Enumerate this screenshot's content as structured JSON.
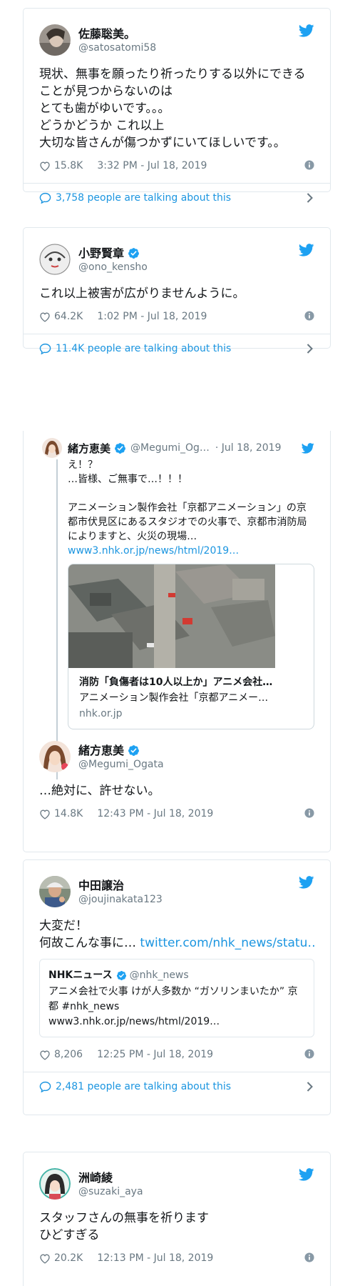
{
  "tweet1": {
    "name": "佐藤聡美。",
    "handle": "@satosatomi58",
    "text": "現状、無事を願ったり祈ったりする以外にできることが見つからないのは\nとても歯がゆいです。。。\nどうかどうか これ以上\n大切な皆さんが傷つかずにいてほしいです。。",
    "likes": "15.8K",
    "time": "3:32 PM - Jul 18, 2019",
    "talking": "3,758 people are talking about this"
  },
  "tweet2": {
    "name": "小野賢章",
    "handle": "@ono_kensho",
    "text": "これ以上被害が広がりませんように。",
    "likes": "64.2K",
    "time": "1:02 PM - Jul 18, 2019",
    "talking": "11.4K people are talking about this"
  },
  "tweet3": {
    "parent": {
      "name": "緒方恵美",
      "handle": "@Megumi_Og…",
      "date": "· Jul 18, 2019",
      "text": "え！？\n…皆様、ご無事で…！！！\n\nアニメーション製作会社「京都アニメーション」の京都市伏見区にあるスタジオでの火事で、京都市消防局によりますと、火災の現場…",
      "link": "www3.nhk.or.jp/news/html/2019…",
      "card_title": "消防「負傷者は10人以上か」アニメ会社…",
      "card_desc": "アニメーション製作会社「京都アニメー…",
      "card_domain": "nhk.or.jp"
    },
    "name": "緒方恵美",
    "handle": "@Megumi_Ogata",
    "text": "…絶対に、許せない。",
    "likes": "14.8K",
    "time": "12:43 PM - Jul 18, 2019"
  },
  "tweet4": {
    "name": "中田譲治",
    "handle": "@joujinakata123",
    "text_line1": "大変だ！",
    "text_line2_prefix": "何故こんな事に… ",
    "text_link": "twitter.com/nhk_news/statu…",
    "quote_name": "NHKニュース",
    "quote_handle": "@nhk_news",
    "quote_text": "アニメ会社で火事 けが人多数か “ガソリンまいたか” 京都 #nhk_news",
    "quote_link": "www3.nhk.or.jp/news/html/2019…",
    "likes": "8,206",
    "time": "12:25 PM - Jul 18, 2019",
    "talking": "2,481 people are talking about this"
  },
  "tweet5": {
    "name": "洲崎綾",
    "handle": "@suzaki_aya",
    "text": "スタッフさんの無事を祈ります\nひどすぎる",
    "likes": "20.2K",
    "time": "12:13 PM - Jul 18, 2019"
  },
  "colors": {
    "accent": "#1b95e0",
    "twitter_blue": "#1da1f2",
    "muted": "#697882",
    "border": "#e1e8ed"
  },
  "icons": {
    "bird": "twitter-bird-icon",
    "verified": "verified-badge-icon",
    "heart": "heart-icon",
    "info": "info-icon",
    "bubble": "comment-bubble-icon",
    "chevron": "chevron-right-icon"
  }
}
